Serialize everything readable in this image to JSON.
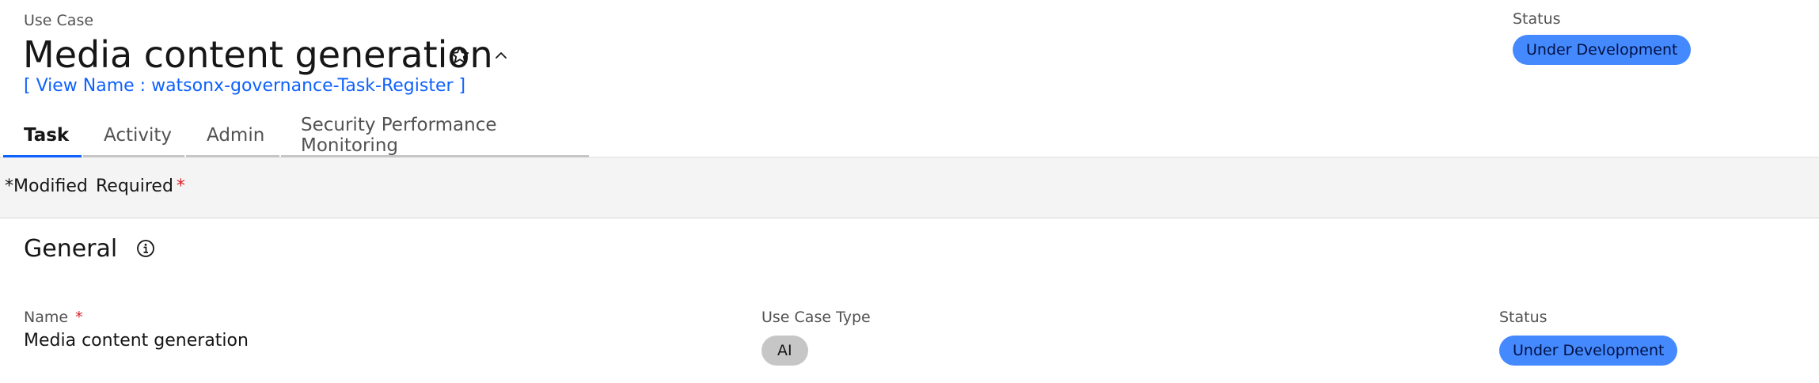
{
  "header": {
    "eyebrow": "Use Case",
    "title": "Media content generation",
    "view_name": "[ View Name : watsonx-governance-Task-Register ]",
    "star_icon": "star-icon",
    "collapse_icon": "chevron-up-icon",
    "status_label": "Status",
    "status_value": "Under Development"
  },
  "tabs": [
    {
      "label": "Task",
      "active": true
    },
    {
      "label": "Activity",
      "active": false
    },
    {
      "label": "Admin",
      "active": false
    },
    {
      "label": "Security Performance Monitoring",
      "active": false
    }
  ],
  "legend": {
    "modified_marker": "*",
    "modified_label": "Modified",
    "required_label": "Required",
    "required_marker": "*"
  },
  "general": {
    "title": "General",
    "info_icon": "info-icon",
    "fields": {
      "name_label": "Name",
      "name_required_marker": "*",
      "name_value": "Media content generation",
      "type_label": "Use Case Type",
      "type_value": "AI",
      "status_label": "Status",
      "status_value": "Under Development"
    }
  },
  "colors": {
    "link": "#0f62fe",
    "status_tag": "#4589ff",
    "type_tag": "#c6c6c6",
    "required": "#da1e28",
    "legend_bg": "#f4f4f4"
  }
}
